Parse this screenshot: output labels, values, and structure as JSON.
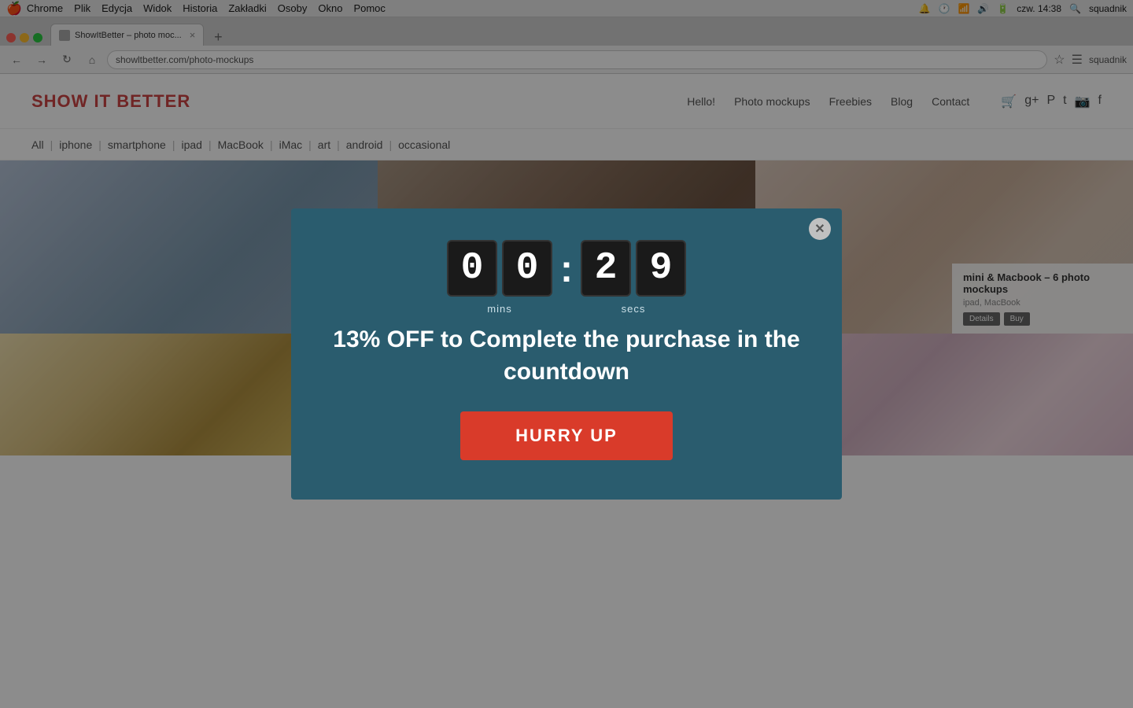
{
  "os": {
    "menubar": {
      "apple": "🍎",
      "items": [
        "Chrome",
        "Plik",
        "Edycja",
        "Widok",
        "Historia",
        "Zakładki",
        "Osoby",
        "Okno",
        "Pomoc"
      ],
      "right_time": "czw. 14:38",
      "right_user": "squadnik"
    }
  },
  "browser": {
    "tab_label": "ShowItBetter – photo moc...",
    "address": "showltbetter.com/photo-mockups",
    "new_tab_icon": "+"
  },
  "site": {
    "logo": "SHOW IT BETTER",
    "nav": {
      "items": [
        "Hello!",
        "Photo mockups",
        "Freebies",
        "Blog",
        "Contact"
      ]
    },
    "filter": {
      "items": [
        "All",
        "iphone",
        "smartphone",
        "ipad",
        "MacBook",
        "iMac",
        "art",
        "android",
        "occasional"
      ]
    }
  },
  "modal": {
    "close_label": "✕",
    "countdown": {
      "mins_d1": "0",
      "mins_d2": "0",
      "secs_d1": "2",
      "secs_d2": "9",
      "mins_label": "mins",
      "secs_label": "secs"
    },
    "promo_text": "13% OFF to Complete the purchase in the countdown",
    "cta_label": "HURRY UP"
  },
  "gallery": {
    "row1": [
      {
        "id": "img-1",
        "css_class": "img-1"
      },
      {
        "id": "img-2",
        "css_class": "img-2"
      },
      {
        "id": "img-3",
        "css_class": "img-3",
        "has_overlay": true,
        "overlay_title": "mini & Macbook – 6 photo mockups",
        "overlay_tags": "ipad, MacBook"
      }
    ],
    "row2": [
      {
        "id": "img-4",
        "css_class": "img-7"
      },
      {
        "id": "img-5",
        "css_class": "img-8"
      },
      {
        "id": "img-6",
        "css_class": "img-9"
      }
    ]
  }
}
